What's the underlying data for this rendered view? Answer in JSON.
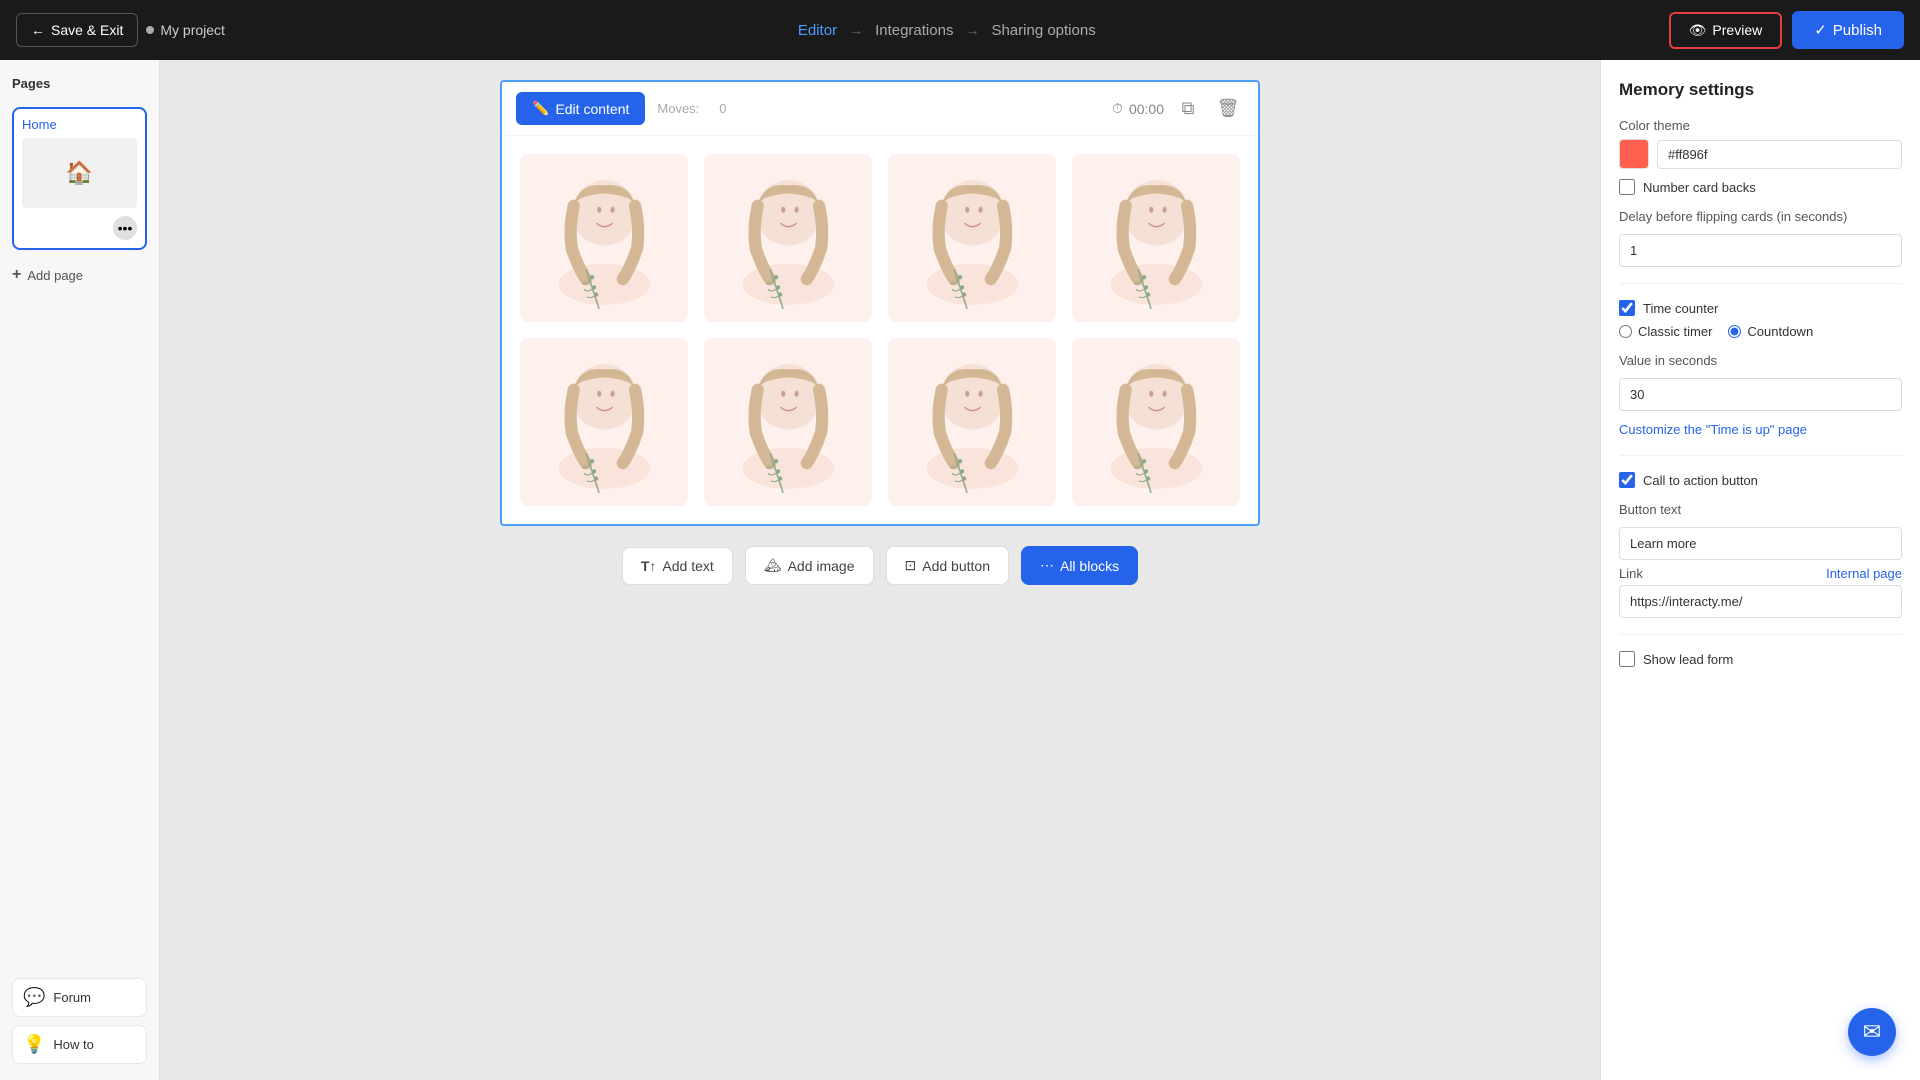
{
  "topNav": {
    "saveExit": "Save & Exit",
    "projectName": "My project",
    "steps": [
      {
        "label": "Editor",
        "state": "active"
      },
      {
        "label": "Integrations",
        "state": "inactive"
      },
      {
        "label": "Sharing options",
        "state": "inactive"
      }
    ],
    "preview": "Preview",
    "publish": "Publish"
  },
  "sidebar": {
    "pagesLabel": "Pages",
    "homePage": "Home",
    "addPage": "Add page",
    "bottomItems": [
      {
        "icon": "forum",
        "label": "Forum"
      },
      {
        "icon": "bulb",
        "label": "How to"
      }
    ]
  },
  "canvas": {
    "editContent": "Edit content",
    "moves": "oves:",
    "movesCount": "0",
    "timerDisplay": "00:00"
  },
  "blockToolbar": [
    {
      "label": "Add text",
      "primary": false
    },
    {
      "label": "Add image",
      "primary": false
    },
    {
      "label": "Add button",
      "primary": false
    },
    {
      "label": "All blocks",
      "primary": true
    }
  ],
  "rightPanel": {
    "title": "Memory settings",
    "colorTheme": {
      "label": "Color theme",
      "value": "#ff896f",
      "hex": "#ff896f"
    },
    "numberCardBacks": {
      "label": "Number card backs",
      "checked": false
    },
    "delayLabel": "Delay before flipping cards (in seconds)",
    "delayValue": "1",
    "timeCounter": {
      "label": "Time counter",
      "checked": true
    },
    "timerOptions": [
      {
        "label": "Classic timer",
        "value": "classic",
        "selected": false
      },
      {
        "label": "Countdown",
        "value": "countdown",
        "selected": true
      }
    ],
    "valueInSeconds": {
      "label": "Value in seconds",
      "value": "30"
    },
    "customizeLink": "Customize the \"Time is up\" page",
    "callToAction": {
      "label": "Call to action button",
      "checked": true
    },
    "buttonText": {
      "label": "Button text",
      "value": "Learn more"
    },
    "link": {
      "label": "Link",
      "internalPage": "Internal page",
      "value": "https://interacty.me/"
    },
    "showLeadForm": {
      "label": "Show lead form",
      "checked": false
    }
  }
}
